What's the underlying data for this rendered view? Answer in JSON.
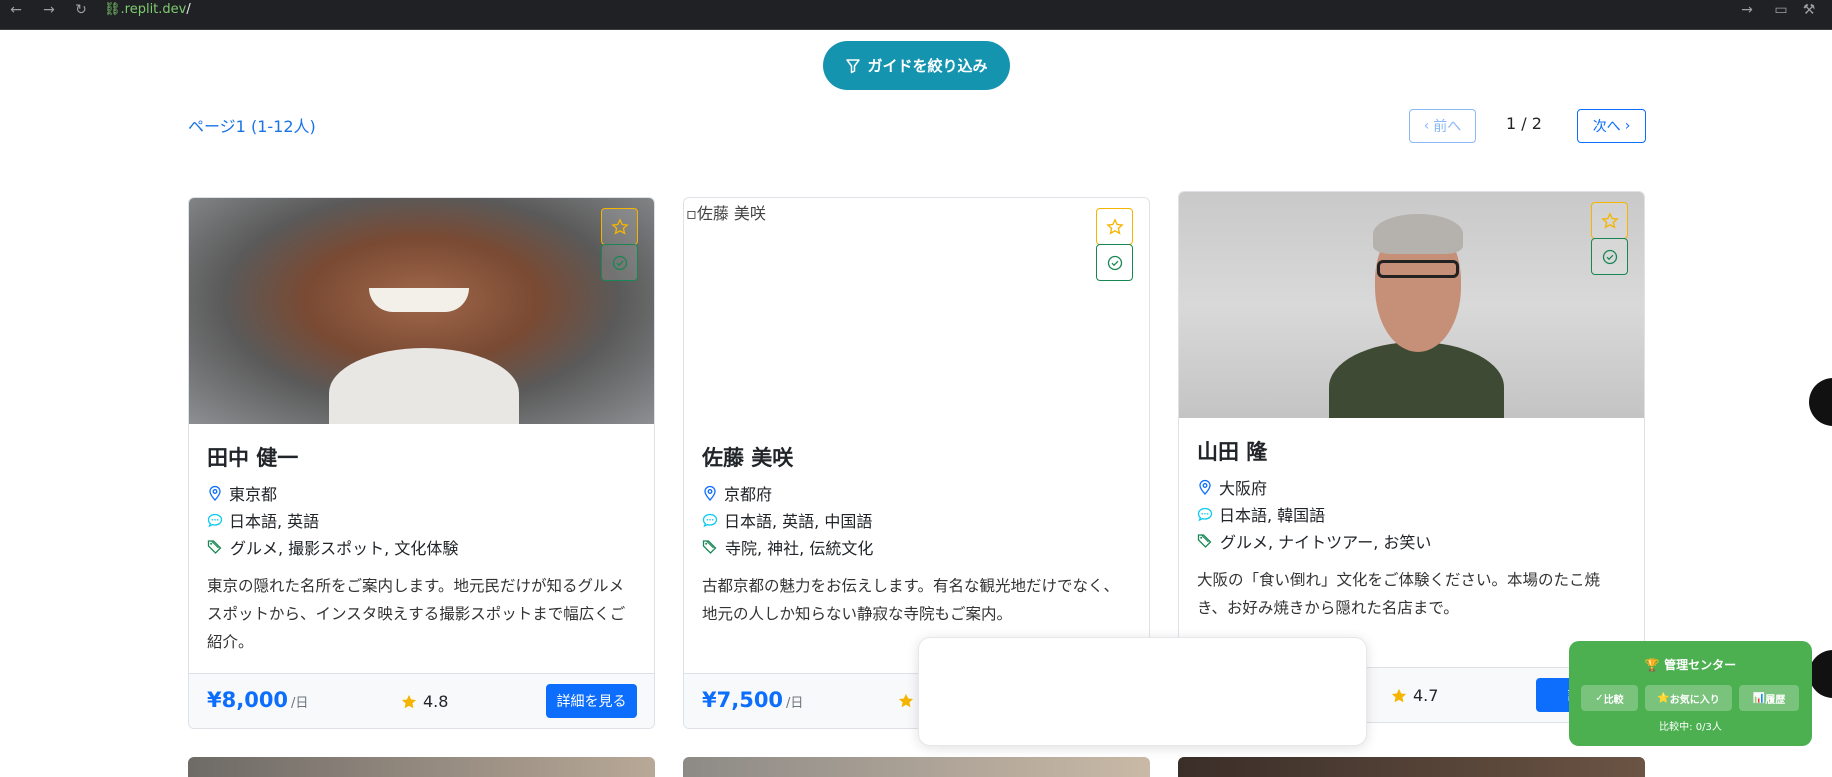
{
  "browser": {
    "url_host": ".replit.dev",
    "url_path": "/"
  },
  "filter": {
    "label": "ガイドを絞り込み"
  },
  "pagination": {
    "info": "ページ1 (1-12人)",
    "prev": "前へ",
    "next": "次へ",
    "current": "1 / 2"
  },
  "guides": [
    {
      "name": "田中 健一",
      "location": "東京都",
      "languages": "日本語, 英語",
      "tags": "グルメ, 撮影スポット, 文化体験",
      "description": "東京の隠れた名所をご案内します。地元民だけが知るグルメスポットから、インスタ映えする撮影スポットまで幅広くご紹介。",
      "price": "¥8,000",
      "per": "/日",
      "rating": "4.8",
      "detail": "詳細を見る",
      "image_alt": ""
    },
    {
      "name": "佐藤 美咲",
      "location": "京都府",
      "languages": "日本語, 英語, 中国語",
      "tags": "寺院, 神社, 伝統文化",
      "description": "古都京都の魅力をお伝えします。有名な観光地だけでなく、地元の人しか知らない静寂な寺院もご案内。",
      "price": "¥7,500",
      "per": "/日",
      "rating": "",
      "detail": "",
      "image_alt": "佐藤 美咲"
    },
    {
      "name": "山田 隆",
      "location": "大阪府",
      "languages": "日本語, 韓国語",
      "tags": "グルメ, ナイトツアー, お笑い",
      "description": "大阪の「食い倒れ」文化をご体験ください。本場のたこ焼き、お好み焼きから隠れた名店まで。",
      "price": "",
      "per": "",
      "rating": "4.7",
      "detail": "詳細",
      "image_alt": ""
    }
  ],
  "management": {
    "title": "管理センター",
    "compare": "比較",
    "favorites": "お気に入り",
    "history": "履歴",
    "status": "比較中: 0/3人"
  },
  "colors": {
    "primary": "#0d6efd",
    "teal": "#1594b0",
    "green_panel": "#4caf50",
    "star": "#f4b400"
  }
}
